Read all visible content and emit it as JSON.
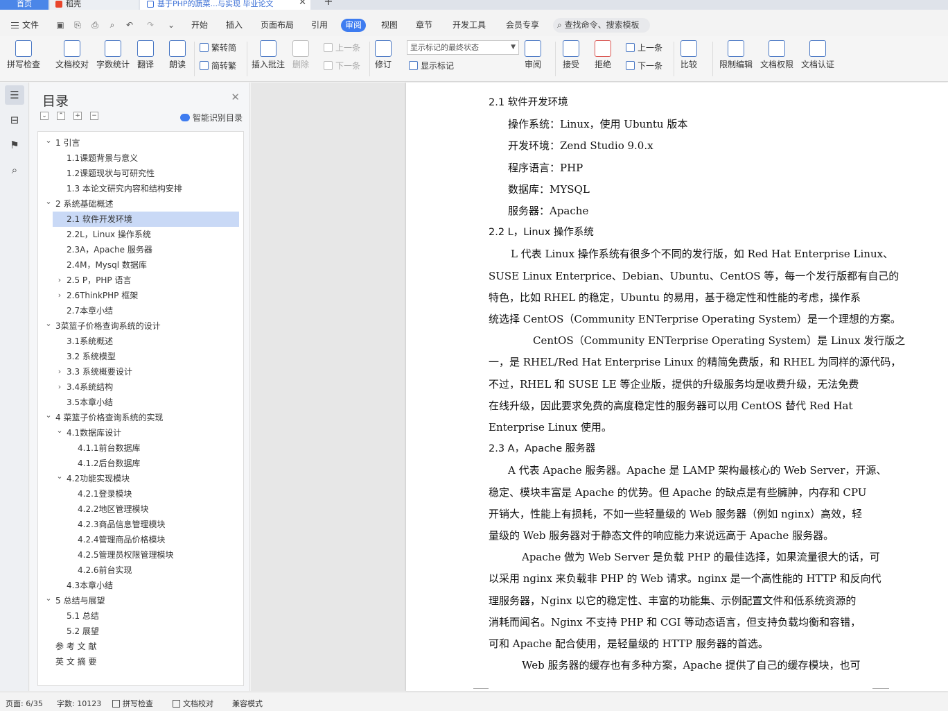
{
  "tabs": {
    "home": "首页",
    "daoke": "稻壳",
    "doc": "基于PHP的蔬菜...与实现 毕业论文"
  },
  "menu": {
    "file": "文件",
    "items": [
      "开始",
      "插入",
      "页面布局",
      "引用",
      "审阅",
      "视图",
      "章节",
      "开发工具",
      "会员专享"
    ],
    "search": "查找命令、搜索模板"
  },
  "ribbon": {
    "spell": "拼写检查",
    "proof": "文档校对",
    "wordcount": "字数统计",
    "translate": "翻译",
    "read": "朗读",
    "t2s": "繁转简",
    "s2t": "简转繁",
    "insert_comment": "插入批注",
    "delete": "删除",
    "prev": "上一条",
    "next": "下一条",
    "revise": "修订",
    "markup_state": "显示标记的最终状态",
    "show_markup": "显示标记",
    "review": "审阅",
    "accept": "接受",
    "reject": "拒绝",
    "prev2": "上一条",
    "next2": "下一条",
    "compare": "比较",
    "restrict": "限制编辑",
    "rights": "文档权限",
    "cert": "文档认证"
  },
  "nav": {
    "title": "目录",
    "smart": "智能识别目录"
  },
  "toc": [
    {
      "label": "1 引言",
      "level": 0,
      "tog": "v"
    },
    {
      "label": "1.1课题背景与意义",
      "level": 1,
      "tog": ""
    },
    {
      "label": "1.2课题现状与可研究性",
      "level": 1,
      "tog": ""
    },
    {
      "label": "1.3 本论文研究内容和结构安排",
      "level": 1,
      "tog": ""
    },
    {
      "label": "2 系统基础概述",
      "level": 0,
      "tog": "v"
    },
    {
      "label": "2.1 软件开发环境",
      "level": 1,
      "tog": "",
      "sel": true
    },
    {
      "label": "2.2L，Linux 操作系统",
      "level": 1,
      "tog": ""
    },
    {
      "label": "2.3A，Apache 服务器",
      "level": 1,
      "tog": ""
    },
    {
      "label": "2.4M，Mysql 数据库",
      "level": 1,
      "tog": ""
    },
    {
      "label": "2.5 P，PHP 语言",
      "level": 1,
      "tog": ">"
    },
    {
      "label": "2.6ThinkPHP 框架",
      "level": 1,
      "tog": ">"
    },
    {
      "label": "2.7本章小结",
      "level": 1,
      "tog": ""
    },
    {
      "label": "3菜篮子价格查询系统的设计",
      "level": 0,
      "tog": "v"
    },
    {
      "label": "3.1系统概述",
      "level": 1,
      "tog": ""
    },
    {
      "label": "3.2 系统模型",
      "level": 1,
      "tog": ""
    },
    {
      "label": "3.3 系统概要设计",
      "level": 1,
      "tog": ">"
    },
    {
      "label": "3.4系统结构",
      "level": 1,
      "tog": ">"
    },
    {
      "label": "3.5本章小结",
      "level": 1,
      "tog": ""
    },
    {
      "label": "4 菜篮子价格查询系统的实现",
      "level": 0,
      "tog": "v"
    },
    {
      "label": "4.1数据库设计",
      "level": 1,
      "tog": "v"
    },
    {
      "label": "4.1.1前台数据库",
      "level": 2,
      "tog": ""
    },
    {
      "label": "4.1.2后台数据库",
      "level": 2,
      "tog": ""
    },
    {
      "label": "4.2功能实现模块",
      "level": 1,
      "tog": "v"
    },
    {
      "label": "4.2.1登录模块",
      "level": 2,
      "tog": ""
    },
    {
      "label": "4.2.2地区管理模块",
      "level": 2,
      "tog": ""
    },
    {
      "label": "4.2.3商品信息管理模块",
      "level": 2,
      "tog": ""
    },
    {
      "label": "4.2.4管理商品价格模块",
      "level": 2,
      "tog": ""
    },
    {
      "label": "4.2.5管理员权限管理模块",
      "level": 2,
      "tog": ""
    },
    {
      "label": "4.2.6前台实现",
      "level": 2,
      "tog": ""
    },
    {
      "label": "4.3本章小结",
      "level": 1,
      "tog": ""
    },
    {
      "label": "5 总结与展望",
      "level": 0,
      "tog": "v"
    },
    {
      "label": "5.1 总结",
      "level": 1,
      "tog": ""
    },
    {
      "label": "5.2 展望",
      "level": 1,
      "tog": ""
    },
    {
      "label": "参 考 文 献",
      "level": -1,
      "tog": ""
    },
    {
      "label": "英 文 摘 要",
      "level": -1,
      "tog": ""
    }
  ],
  "doc": [
    {
      "t": "2.1 软件开发环境",
      "h": 1,
      "x": 0
    },
    {
      "t": "操作系统：Linux，使用 Ubuntu 版本",
      "x": 28
    },
    {
      "t": "开发环境：Zend Studio 9.0.x",
      "x": 28
    },
    {
      "t": "程序语言：PHP",
      "x": 28
    },
    {
      "t": "数据库：MYSQL",
      "x": 28
    },
    {
      "t": "服务器：Apache",
      "x": 28
    },
    {
      "t": "2.2 L，Linux 操作系统",
      "h": 1,
      "x": 0
    },
    {
      "t": "L 代表 Linux 操作系统有很多个不同的发行版，如 Red Hat Enterprise Linux、",
      "x": 32
    },
    {
      "t": "SUSE Linux Enterprice、Debian、Ubuntu、CentOS 等，每一个发行版都有自己的",
      "x": 0
    },
    {
      "t": "特色，比如 RHEL 的稳定，Ubuntu 的易用，基于稳定性和性能的考虑，操作系",
      "x": 0
    },
    {
      "t": "统选择 CentOS（Community ENTerprise Operating System）是一个理想的方案。",
      "x": 0
    },
    {
      "t": "CentOS（Community ENTerprise Operating System）是 Linux 发行版之",
      "x": 64
    },
    {
      "t": "一，是 RHEL/Red Hat Enterprise Linux 的精简免费版，和 RHEL 为同样的源代码，",
      "x": 0
    },
    {
      "t": "不过，RHEL 和 SUSE LE 等企业版，提供的升级服务均是收费升级，无法免费",
      "x": 0
    },
    {
      "t": "在线升级，因此要求免费的高度稳定性的服务器可以用 CentOS 替代 Red Hat",
      "x": 0
    },
    {
      "t": "Enterprise Linux 使用。",
      "x": 0
    },
    {
      "t": "2.3 A，Apache 服务器",
      "h": 1,
      "x": 0
    },
    {
      "t": "A 代表 Apache 服务器。Apache 是 LAMP 架构最核心的 Web Server，开源、",
      "x": 28
    },
    {
      "t": "稳定、模块丰富是 Apache 的优势。但 Apache 的缺点是有些臃肿，内存和 CPU",
      "x": 0
    },
    {
      "t": "开销大，性能上有损耗，不如一些轻量级的 Web 服务器（例如 nginx）高效，轻",
      "x": 0
    },
    {
      "t": "量级的 Web 服务器对于静态文件的响应能力来说远高于 Apache 服务器。",
      "x": 0
    },
    {
      "t": "Apache 做为 Web Server 是负载 PHP 的最佳选择，如果流量很大的话，可",
      "x": 48
    },
    {
      "t": "以采用 nginx 来负载非 PHP 的 Web 请求。nginx 是一个高性能的 HTTP 和反向代",
      "x": 0
    },
    {
      "t": "理服务器，Nginx 以它的稳定性、丰富的功能集、示例配置文件和低系统资源的",
      "x": 0
    },
    {
      "t": "消耗而闻名。Nginx 不支持 PHP 和 CGI 等动态语言，但支持负载均衡和容错，",
      "x": 0
    },
    {
      "t": "可和 Apache 配合使用，是轻量级的 HTTP 服务器的首选。",
      "x": 0
    },
    {
      "t": "Web 服务器的缓存也有多种方案，Apache 提供了自己的缓存模块，也可",
      "x": 48
    }
  ],
  "status": {
    "page": "页面: 6/35",
    "words": "字数: 10123",
    "spell": "拼写检查",
    "proof": "文档校对",
    "compat": "兼容模式"
  }
}
